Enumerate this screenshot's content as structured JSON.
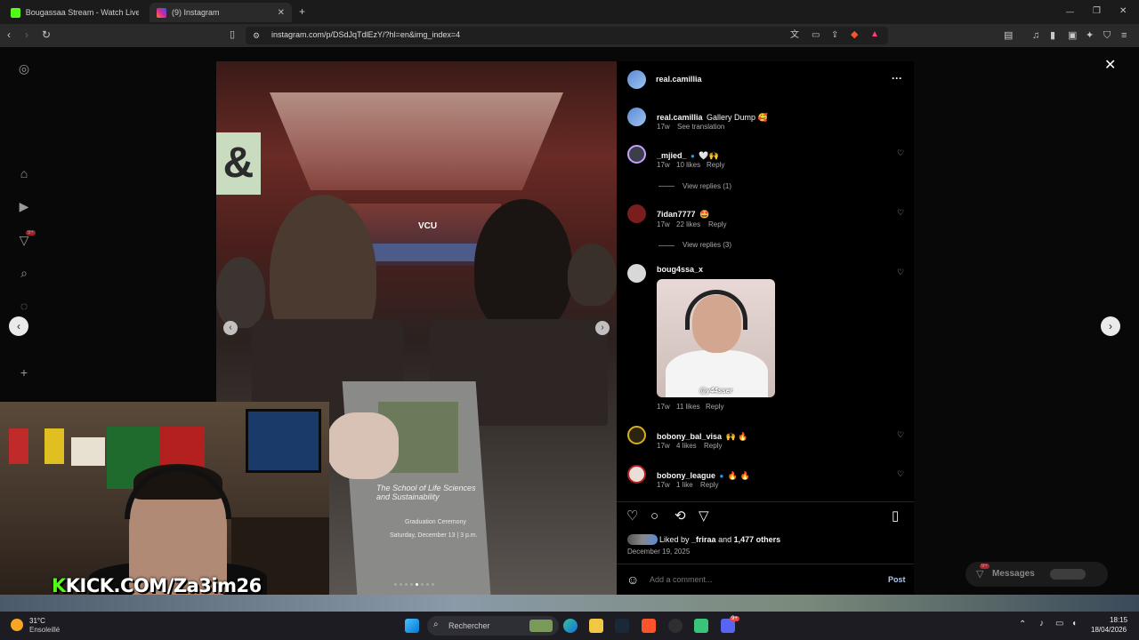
{
  "browser": {
    "tabs": [
      {
        "label": "Bougassaa Stream - Watch Live on K",
        "active": false,
        "favicon_color": "#53fc18"
      },
      {
        "label": "(9) Instagram",
        "active": true,
        "favicon_color": "#d6249f"
      }
    ],
    "new_tab": "+",
    "url": "instagram.com/p/DSdJqTdlEzY/?hl=en&img_index=4",
    "window_controls": {
      "minimize": "—",
      "restore": "❐",
      "close": "✕"
    }
  },
  "sidebar": {
    "icons": [
      "instagram-icon",
      "home-icon",
      "reels-icon",
      "send-icon",
      "search-icon",
      "explore-icon",
      "heart-icon",
      "create-icon",
      "more-icon"
    ],
    "notification_badge": "9+"
  },
  "post": {
    "author": "real.camillia",
    "caption_user": "real.camillia",
    "caption_text": "Gallery Dump 🥰",
    "caption_time": "17w",
    "see_translation": "See translation",
    "photo": {
      "program_title": "The School of Life Sciences and Sustainability",
      "program_subtitle": "Graduation Ceremony",
      "program_date": "Saturday, December 13 | 3 p.m.",
      "stage_logo": "VCU",
      "dot_count": 8,
      "active_dot": 4
    },
    "comments": [
      {
        "user": "_mjied_",
        "verified": true,
        "text": "🤍🙌",
        "time": "17w",
        "likes": "10 likes",
        "reply": "Reply",
        "view_replies": "View replies (1)"
      },
      {
        "user": "7idan7777",
        "verified": false,
        "text": "🤩",
        "time": "17w",
        "likes": "22 likes",
        "reply": "Reply",
        "view_replies": "View replies (3)"
      },
      {
        "user": "boug4ssa_x",
        "verified": false,
        "text": "",
        "time": "17w",
        "likes": "11 likes",
        "reply": "Reply",
        "gif_watermark": "@y44sser"
      },
      {
        "user": "bobony_bal_visa",
        "verified": false,
        "text": "🙌 🔥",
        "time": "17w",
        "likes": "4 likes",
        "reply": "Reply"
      },
      {
        "user": "bobony_league",
        "verified": true,
        "text": "🔥 🔥",
        "time": "17w",
        "likes": "1 like",
        "reply": "Reply"
      }
    ],
    "liked_by_prefix": "Liked by",
    "liked_by_user": "_friraa",
    "liked_by_and": "and",
    "liked_by_count": "1,477 others",
    "date": "December 19, 2025",
    "comment_placeholder": "Add a comment...",
    "post_button": "Post"
  },
  "overlay_right": {
    "messages_label": "Messages",
    "messages_badge": "9+"
  },
  "stream": {
    "banner_k": "K",
    "banner_text": "KICK.COM/Za3im26"
  },
  "taskbar": {
    "weather_temp": "31°C",
    "weather_desc": "Ensoleillé",
    "search_placeholder": "Rechercher",
    "time": "18:15",
    "date": "18/04/2026",
    "discord_badge": "9+"
  },
  "colors": {
    "kick_green": "#53fc18",
    "instagram_blue": "#0095f6",
    "panel_bg": "#000000",
    "verified_blue": "#1d9bf0"
  }
}
